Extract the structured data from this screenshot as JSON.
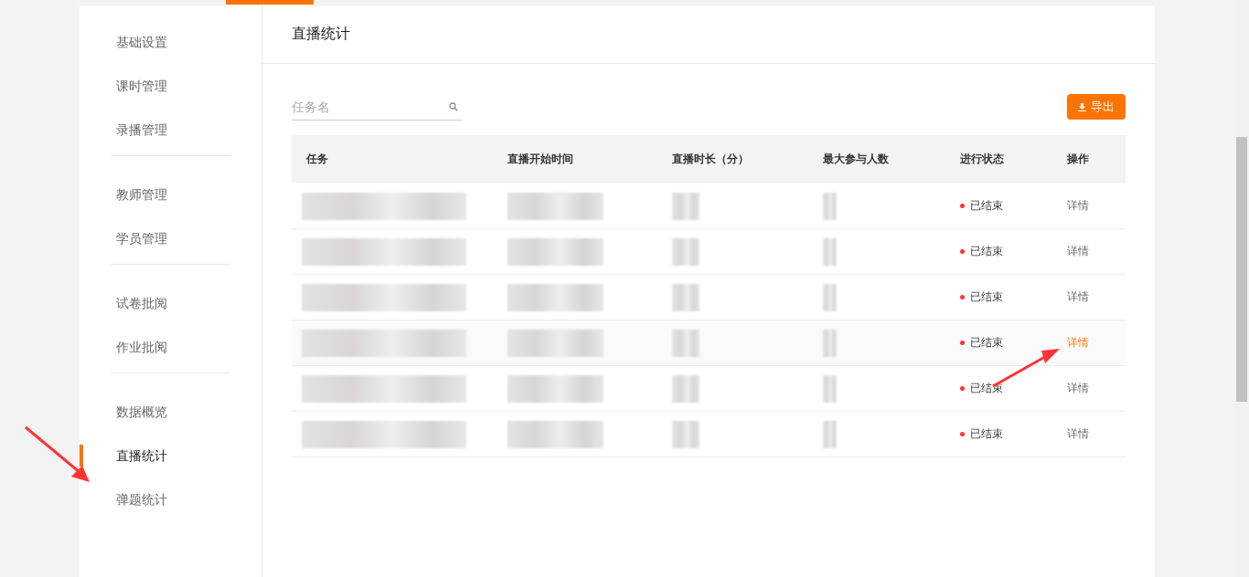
{
  "sidebar": {
    "groups": [
      {
        "items": [
          {
            "label": "基础设置",
            "selected": false
          },
          {
            "label": "课时管理",
            "selected": false
          },
          {
            "label": "录播管理",
            "selected": false
          }
        ]
      },
      {
        "items": [
          {
            "label": "教师管理",
            "selected": false
          },
          {
            "label": "学员管理",
            "selected": false
          }
        ]
      },
      {
        "items": [
          {
            "label": "试卷批阅",
            "selected": false
          },
          {
            "label": "作业批阅",
            "selected": false
          }
        ]
      },
      {
        "items": [
          {
            "label": "数据概览",
            "selected": false
          },
          {
            "label": "直播统计",
            "selected": true
          },
          {
            "label": "弹题统计",
            "selected": false
          }
        ]
      }
    ]
  },
  "page_title": "直播统计",
  "search": {
    "placeholder": "任务名"
  },
  "export_button": "导出",
  "table": {
    "columns": [
      "任务",
      "直播开始时间",
      "直播时长（分）",
      "最大参与人数",
      "进行状态",
      "操作"
    ],
    "rows": [
      {
        "status": "已结束",
        "action": "详情",
        "selected": false
      },
      {
        "status": "已结束",
        "action": "详情",
        "selected": false
      },
      {
        "status": "已结束",
        "action": "详情",
        "selected": false
      },
      {
        "status": "已结束",
        "action": "详情",
        "selected": true
      },
      {
        "status": "已结束",
        "action": "详情",
        "selected": false
      },
      {
        "status": "已结束",
        "action": "详情",
        "selected": false
      }
    ]
  }
}
